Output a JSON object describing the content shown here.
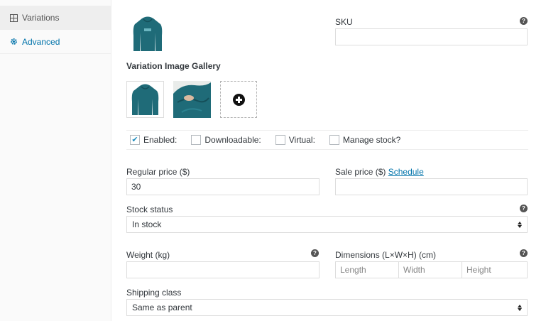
{
  "sidebar": {
    "items": [
      {
        "label": "Variations",
        "icon": "grid-icon"
      },
      {
        "label": "Advanced",
        "icon": "gear-icon"
      }
    ]
  },
  "variation": {
    "sku_label": "SKU",
    "sku_value": "",
    "gallery_title": "Variation Image Gallery",
    "checkboxes": [
      {
        "label": "Enabled:",
        "checked": true
      },
      {
        "label": "Downloadable:",
        "checked": false
      },
      {
        "label": "Virtual:",
        "checked": false
      },
      {
        "label": "Manage stock?",
        "checked": false
      }
    ],
    "regular_price_label": "Regular price ($)",
    "regular_price_value": "30",
    "sale_price_label": "Sale price ($)",
    "schedule_link": "Schedule",
    "sale_price_value": "",
    "stock_status_label": "Stock status",
    "stock_status_value": "In stock",
    "weight_label": "Weight (kg)",
    "weight_value": "",
    "dimensions_label": "Dimensions (L×W×H) (cm)",
    "length_placeholder": "Length",
    "width_placeholder": "Width",
    "height_placeholder": "Height",
    "shipping_class_label": "Shipping class",
    "shipping_class_value": "Same as parent",
    "help_glyph": "?"
  },
  "colors": {
    "link": "#0073aa",
    "check": "#1e8cbe",
    "hoodie": "#1f6b78"
  }
}
